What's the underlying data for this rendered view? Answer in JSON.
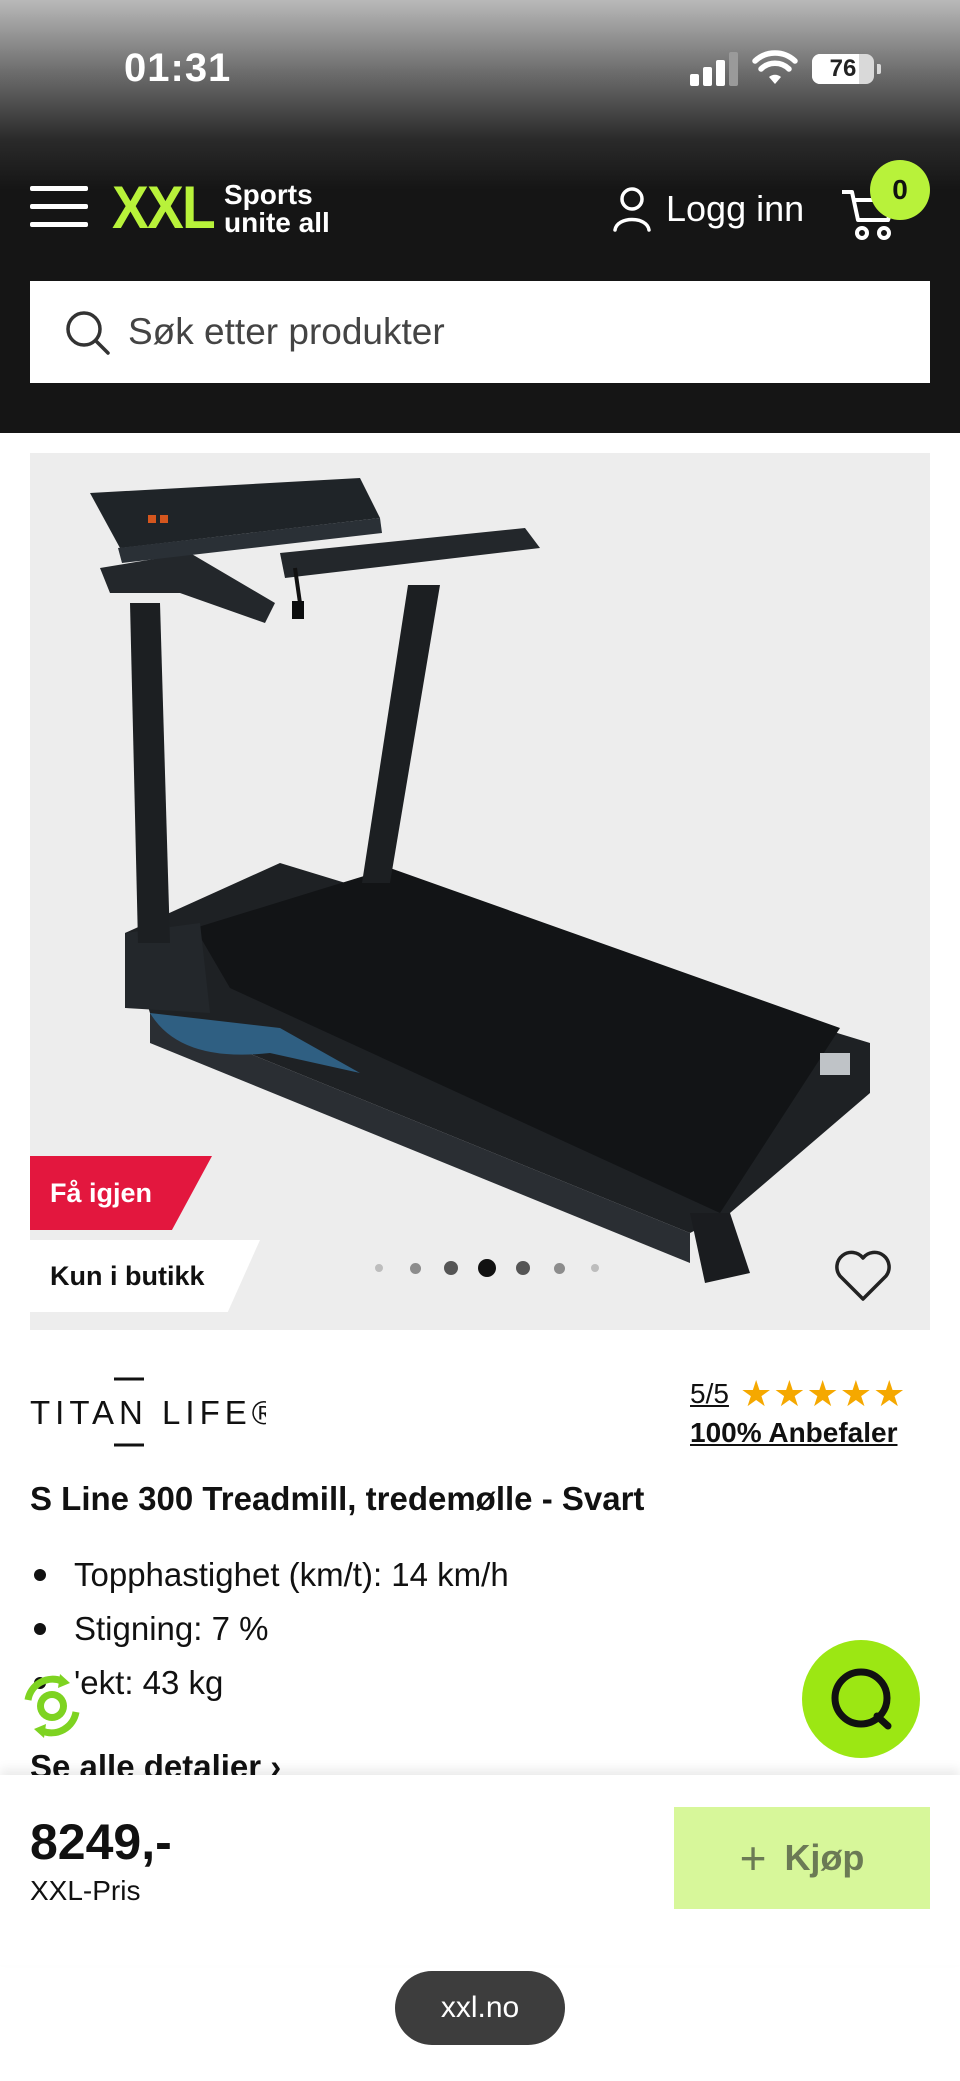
{
  "status_bar": {
    "time": "01:31",
    "battery": "76",
    "battery_level": 0.76
  },
  "header": {
    "logo_text": "XXL",
    "logo_tagline": "Sports unite all",
    "login_label": "Logg inn",
    "cart_count": "0",
    "brand_color": "#b8f23a"
  },
  "search": {
    "placeholder": "Søk etter produkter"
  },
  "gallery": {
    "badges": [
      "Få igjen",
      "Kun i butikk"
    ],
    "slide_count": 7,
    "active_slide": 4
  },
  "product": {
    "brand": "TITAN LIFE®",
    "rating_score": "5/5",
    "rating_value": 5,
    "rating_max": 5,
    "recommend_text": "100% Anbefaler",
    "title": "S Line 300 Treadmill, tredemølle - Svart",
    "specs": [
      "Topphastighet (km/t): 14 km/h",
      "Stigning: 7 %",
      "'ekt: 43 kg"
    ],
    "see_all_label": "Se alle detalier ›"
  },
  "purchase": {
    "price": "8249,-",
    "price_label": "XXL-Pris",
    "buy_label": "Kjøp",
    "buy_color": "#d7f79a"
  },
  "browser": {
    "url": "xxl.no"
  }
}
